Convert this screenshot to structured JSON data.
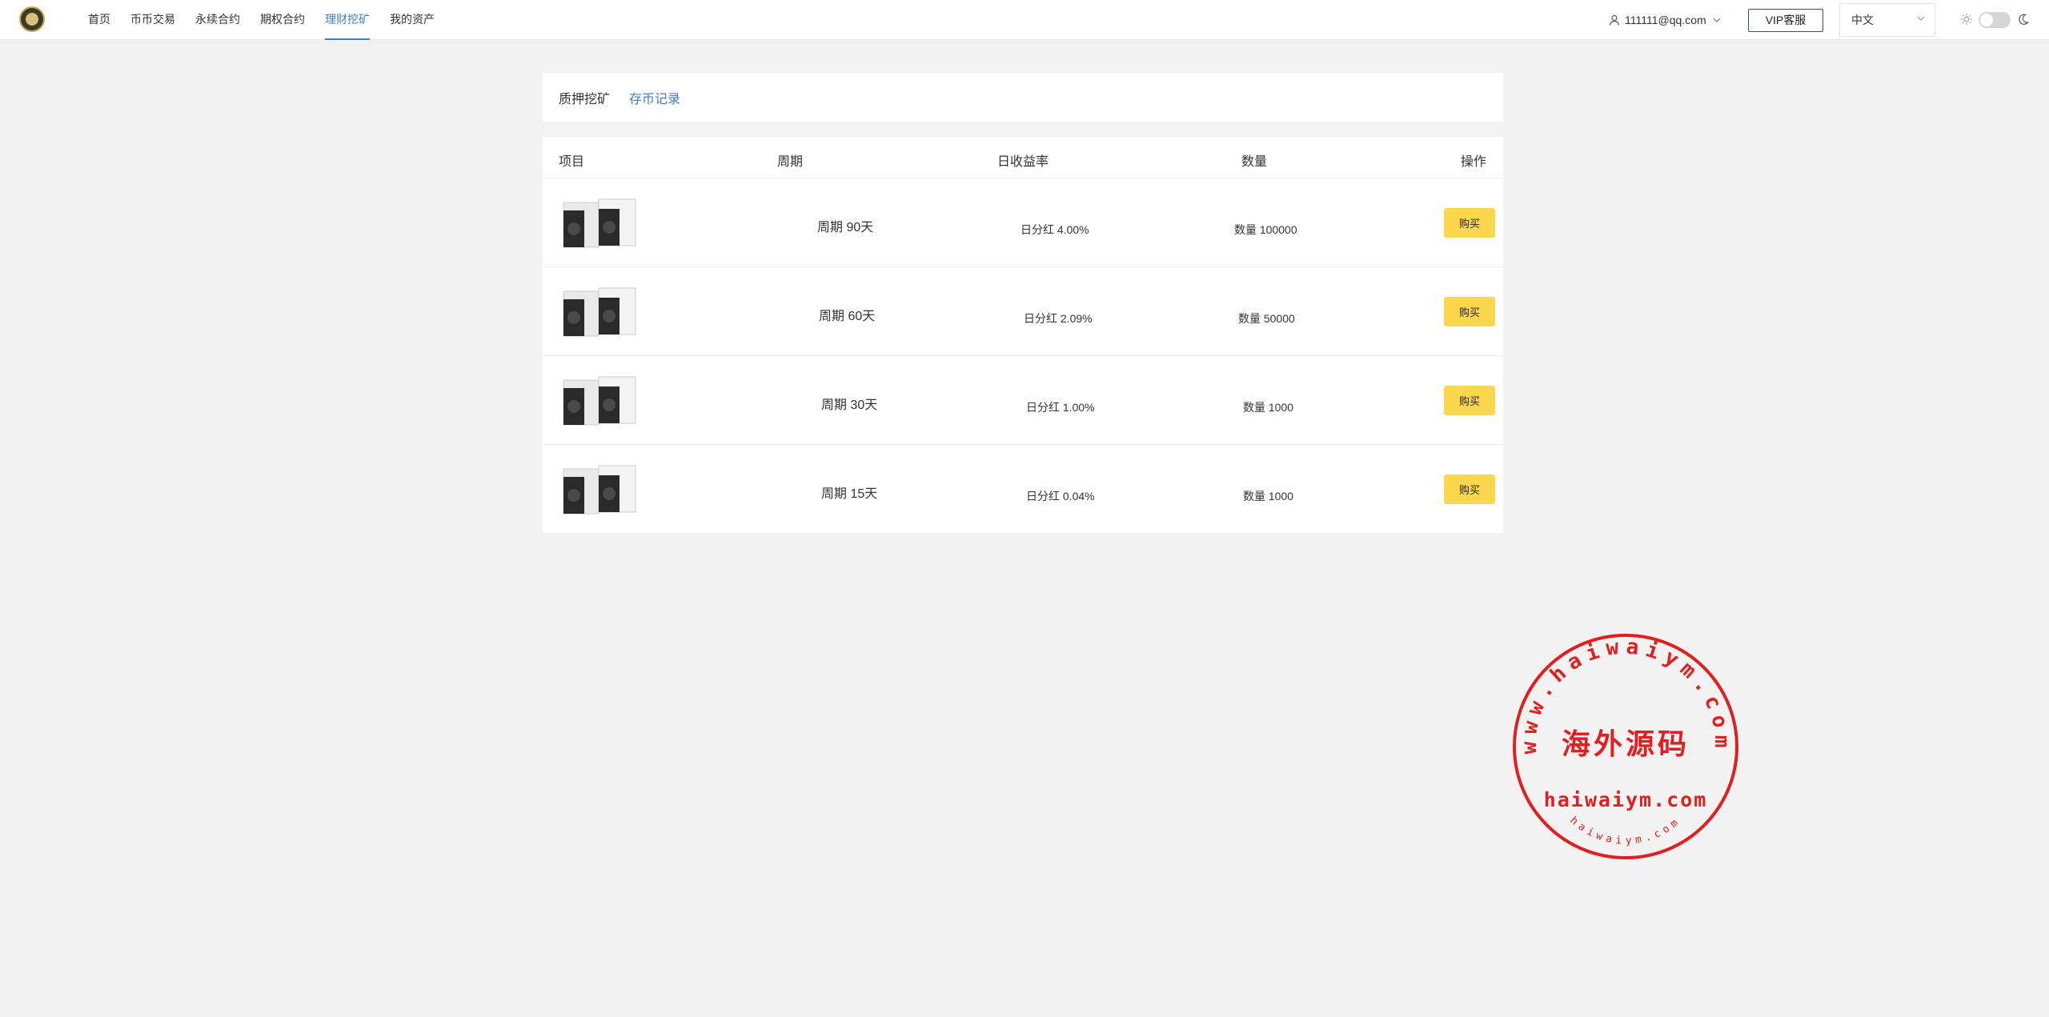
{
  "nav": {
    "items": [
      {
        "label": "首页",
        "active": false
      },
      {
        "label": "币币交易",
        "active": false
      },
      {
        "label": "永续合约",
        "active": false
      },
      {
        "label": "期权合约",
        "active": false
      },
      {
        "label": "理财挖矿",
        "active": true
      },
      {
        "label": "我的资产",
        "active": false
      }
    ]
  },
  "header": {
    "user_email": "111111@qq.com",
    "vip_label": "VIP客服",
    "language": "中文",
    "icons": [
      "user-icon",
      "chevron-down-icon",
      "sun-icon",
      "theme-toggle",
      "moon-icon"
    ]
  },
  "tabs": [
    {
      "label": "质押挖矿",
      "active": true
    },
    {
      "label": "存币记录",
      "active": false
    }
  ],
  "table": {
    "headers": [
      "项目",
      "周期",
      "日收益率",
      "数量",
      "操作"
    ],
    "rows": [
      {
        "period": "周期 90天",
        "rate": "日分红 4.00%",
        "quantity": "数量 100000",
        "action": "购买"
      },
      {
        "period": "周期 60天",
        "rate": "日分红 2.09%",
        "quantity": "数量 50000",
        "action": "购买"
      },
      {
        "period": "周期 30天",
        "rate": "日分红 1.00%",
        "quantity": "数量 1000",
        "action": "购买"
      },
      {
        "period": "周期 15天",
        "rate": "日分红 0.04%",
        "quantity": "数量 1000",
        "action": "购买"
      }
    ]
  },
  "watermark": {
    "ring_text": "www.haiwaiym.com",
    "center_text": "海外源码",
    "domain_text": "haiwaiym.com",
    "small_text": "haiwaiym.com",
    "color": "#e02020"
  },
  "colors": {
    "accent": "#3d7fc8",
    "buy_button": "#fbd74e",
    "background": "#f2f2f2"
  }
}
